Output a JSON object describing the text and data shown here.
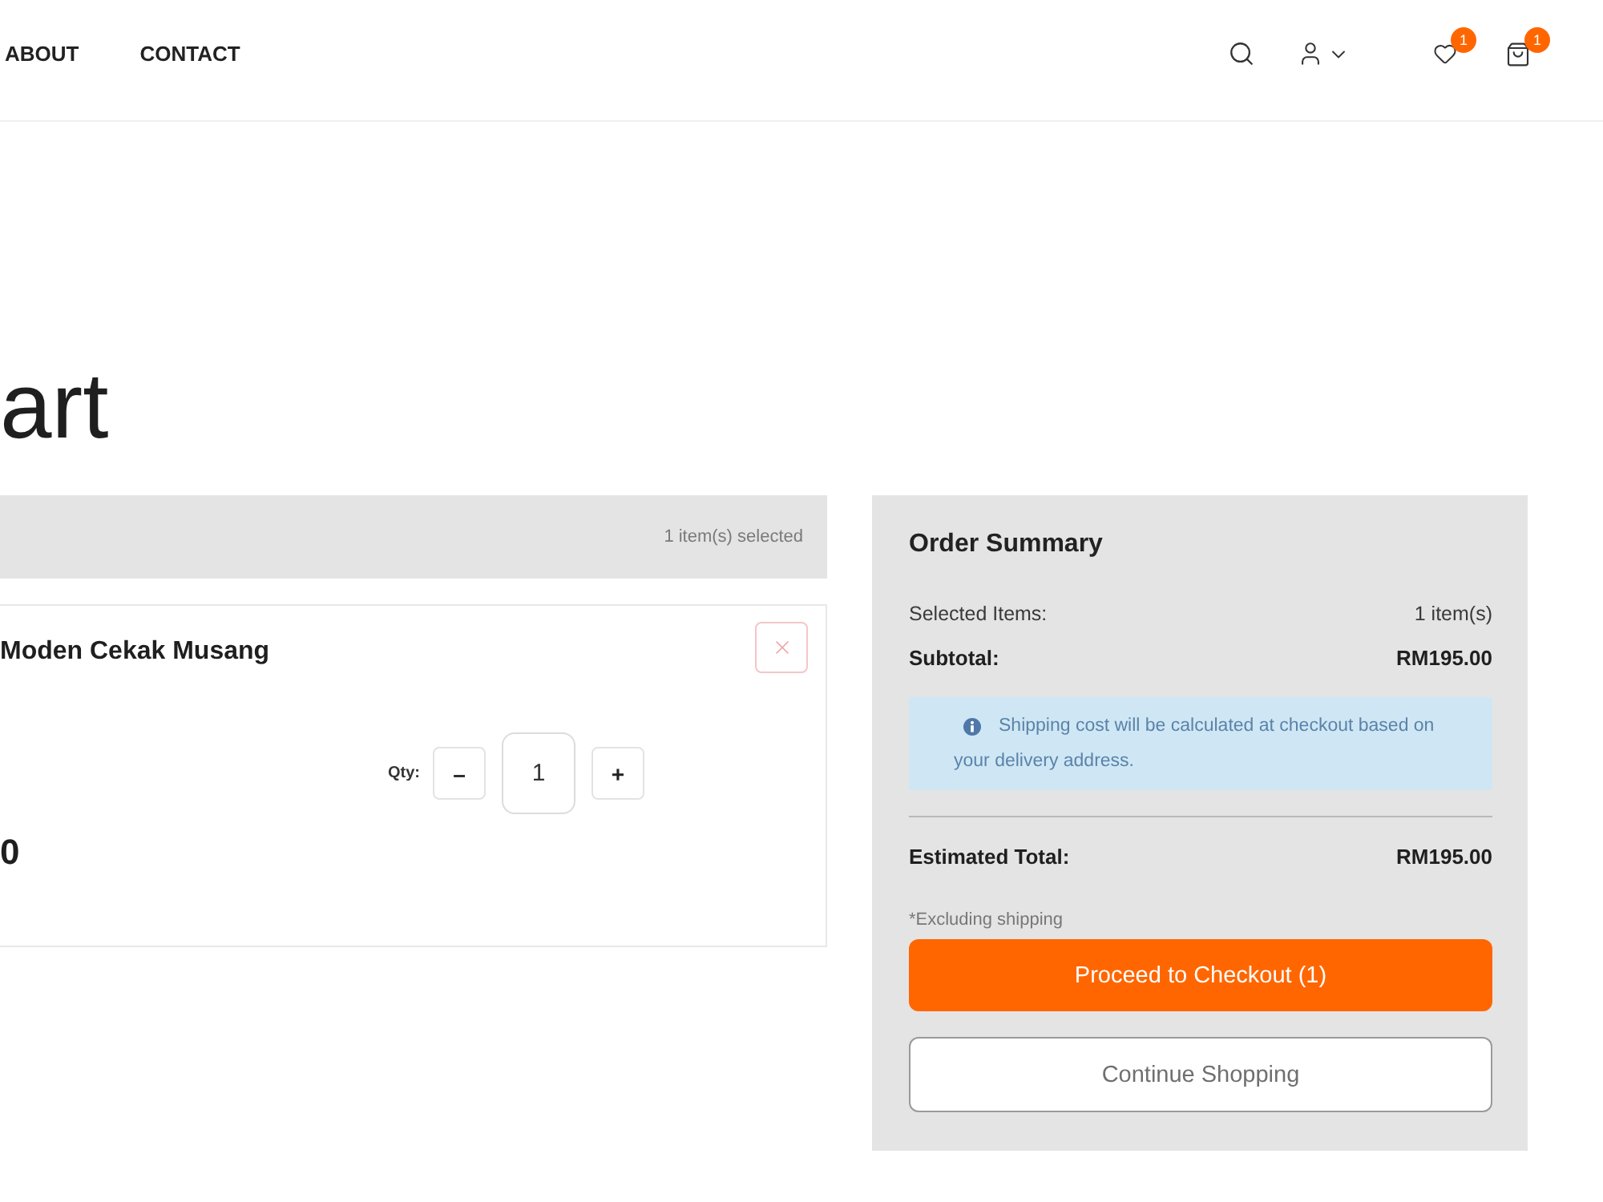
{
  "header": {
    "links": [
      {
        "label": "ABOUT"
      },
      {
        "label": "CONTACT"
      }
    ],
    "wishlist_badge": "1",
    "cart_badge": "1"
  },
  "page_title": "art",
  "cart": {
    "selection_label": "1 item(s) selected",
    "items": [
      {
        "name": "Moden Cekak Musang",
        "qty_label": "Qty:",
        "decrement": "–",
        "quantity": "1",
        "increment": "+",
        "price": "0"
      }
    ]
  },
  "summary": {
    "title": "Order Summary",
    "rows": [
      {
        "label": "Selected Items:",
        "value": "1 item(s)",
        "kind": "plain"
      },
      {
        "label": "Subtotal:",
        "value": "RM195.00",
        "kind": "bold"
      }
    ],
    "notice": "Shipping cost will be calculated at checkout based on your delivery address.",
    "total": {
      "label": "Estimated Total:",
      "value": "RM195.00"
    },
    "note": "*Excluding shipping",
    "buttons": [
      {
        "label": "Proceed to Checkout (1)",
        "kind": "primary"
      },
      {
        "label": "Continue Shopping",
        "kind": "secondary"
      }
    ]
  }
}
